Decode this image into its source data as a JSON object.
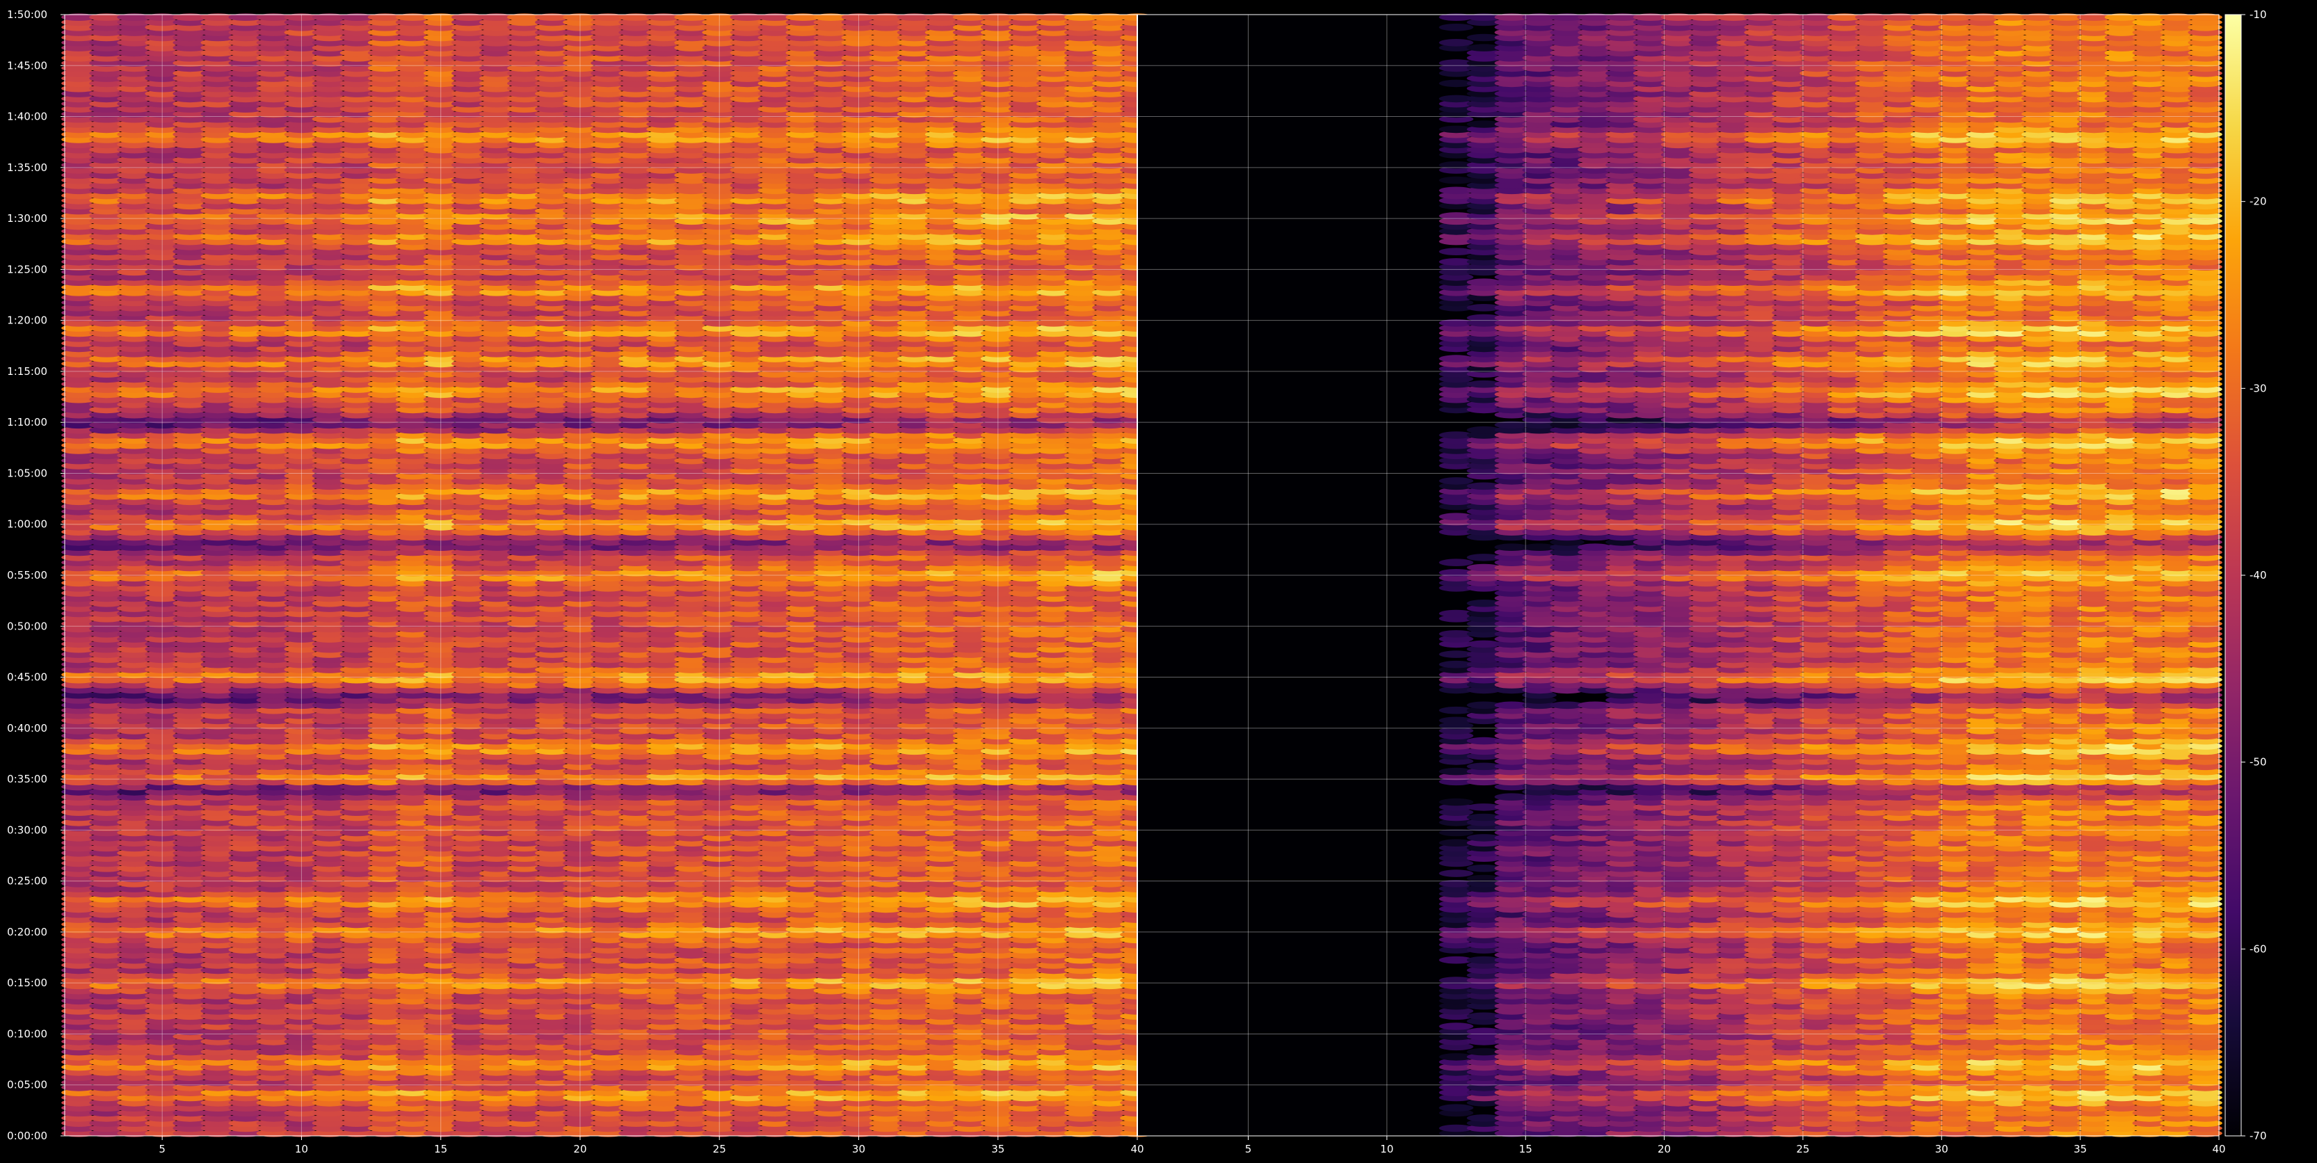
{
  "chart_data": {
    "type": "heatmap",
    "title": "",
    "xlabel": "",
    "ylabel": "",
    "panels": [
      {
        "name": "",
        "xlim": [
          1.5,
          40
        ],
        "xticks": [
          5,
          10,
          15,
          20,
          25,
          30,
          35,
          40
        ],
        "xticklabels": [
          "5",
          "10",
          "15",
          "20",
          "25",
          "30",
          "35",
          "40"
        ],
        "active_x": [
          1.5,
          39.7
        ]
      },
      {
        "name": "",
        "xlim": [
          1,
          40
        ],
        "xticks": [
          5,
          10,
          15,
          20,
          25,
          30,
          35,
          40
        ],
        "xticklabels": [
          "5",
          "10",
          "15",
          "20",
          "25",
          "30",
          "35",
          "40"
        ],
        "active_x": [
          12.0,
          39.7
        ]
      }
    ],
    "ylim_seconds": [
      0,
      6600
    ],
    "yticks_seconds": [
      0,
      300,
      600,
      900,
      1200,
      1500,
      1800,
      2100,
      2400,
      2700,
      3000,
      3300,
      3600,
      3900,
      4200,
      4500,
      4800,
      5100,
      5400,
      5700,
      6000,
      6300,
      6600
    ],
    "yticklabels": [
      "0:00:00",
      "0:05:00",
      "0:10:00",
      "0:15:00",
      "0:20:00",
      "0:25:00",
      "0:30:00",
      "0:35:00",
      "0:40:00",
      "0:45:00",
      "0:50:00",
      "0:55:00",
      "1:00:00",
      "1:05:00",
      "1:10:00",
      "1:15:00",
      "1:20:00",
      "1:25:00",
      "1:30:00",
      "1:35:00",
      "1:40:00",
      "1:45:00",
      "1:50:00"
    ],
    "colorbar": {
      "colormap": "inferno",
      "range": [
        -70,
        -10
      ],
      "ticks": [
        -70,
        -60,
        -50,
        -40,
        -30,
        -20,
        -10
      ],
      "ticklabels": [
        "-70",
        "-60",
        "-50",
        "-40",
        "-30",
        "-20",
        "-10"
      ]
    },
    "hot_rows_seconds": [
      240,
      420,
      900,
      1200,
      1380,
      2100,
      2280,
      2700,
      3300,
      3600,
      3780,
      4080,
      4380,
      4560,
      4740,
      4980,
      5280,
      5400,
      5520,
      5880
    ],
    "dark_rows_seconds": [
      2040,
      2580,
      3480,
      4200
    ],
    "grid": true
  }
}
